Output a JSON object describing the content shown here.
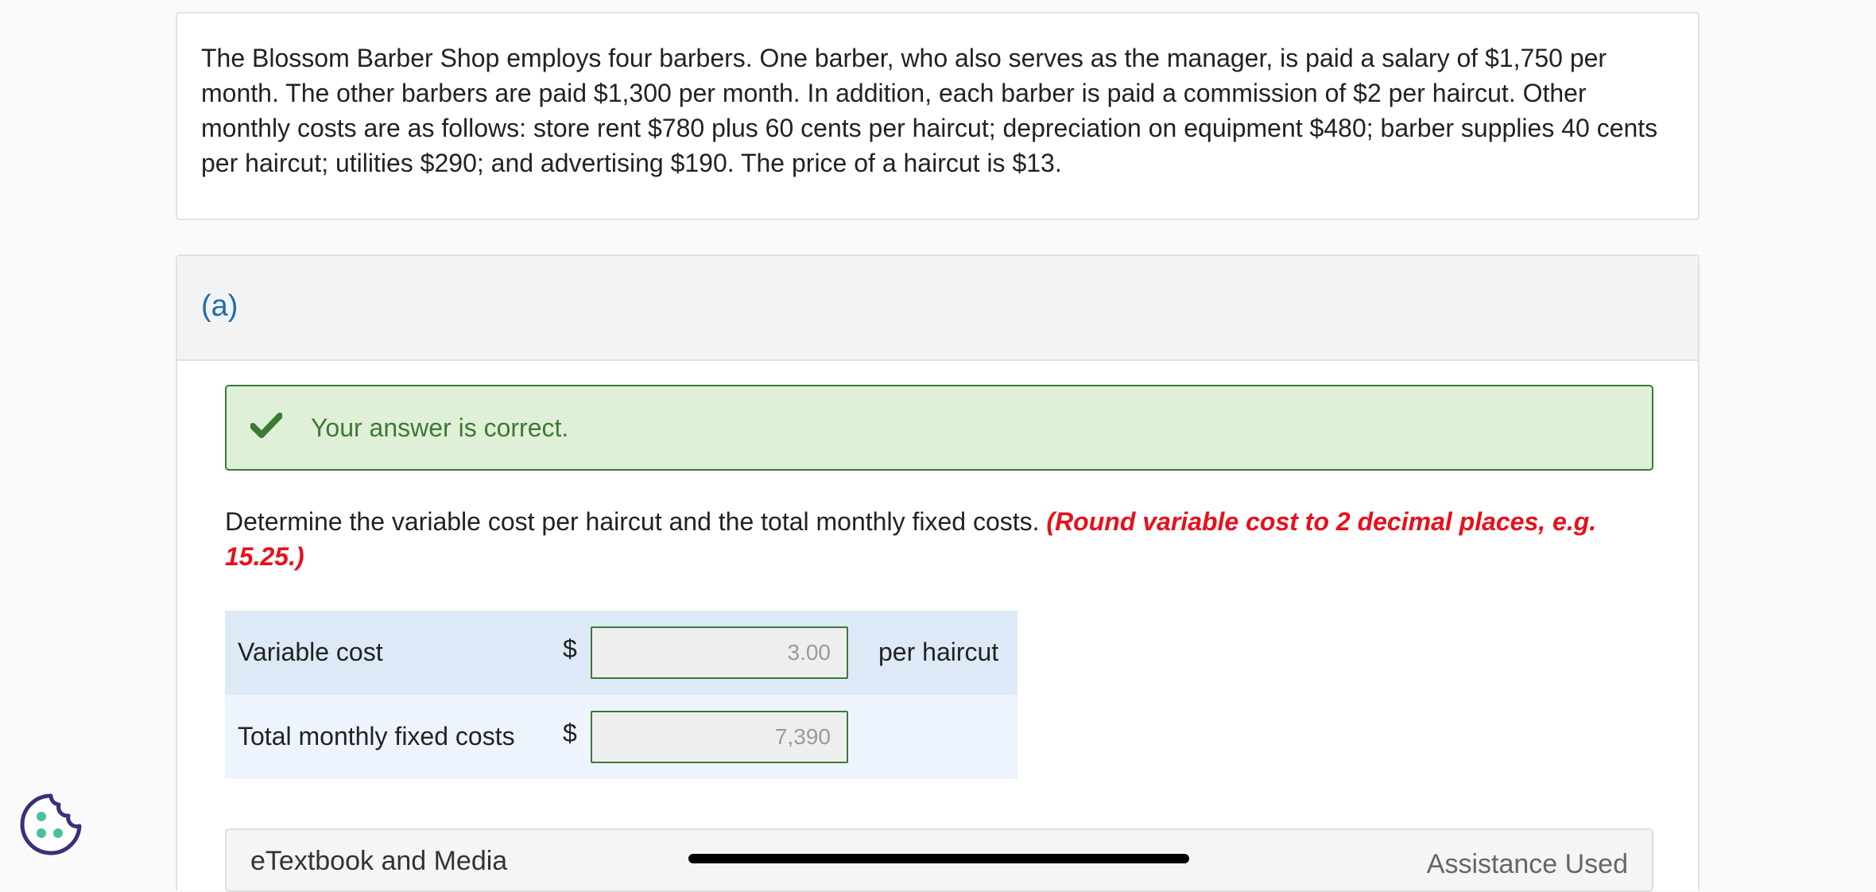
{
  "problem": {
    "text": "The Blossom Barber Shop employs four barbers. One barber, who also serves as the manager, is paid a salary of $1,750 per month. The other barbers are paid $1,300 per month. In addition, each barber is paid a commission of $2 per haircut. Other monthly costs are as follows: store rent $780 plus 60 cents per haircut; depreciation on equipment $480; barber supplies 40 cents per haircut; utilities $290; and advertising $190. The price of a haircut is $13."
  },
  "part": {
    "label": "(a)",
    "feedback": "Your answer is correct.",
    "question": "Determine the variable cost per haircut and the total monthly fixed costs.",
    "hint": "(Round variable cost to 2 decimal places, e.g. 15.25.)",
    "rows": [
      {
        "label": "Variable cost",
        "currency": "$",
        "value": "3.00",
        "unit": "per haircut"
      },
      {
        "label": "Total monthly fixed costs",
        "currency": "$",
        "value": "7,390",
        "unit": ""
      }
    ]
  },
  "footer": {
    "etextbook": "eTextbook and Media",
    "assistance": "Assistance Used"
  },
  "colors": {
    "correct_green": "#3b7a33",
    "hint_red": "#e8101a",
    "part_label_blue": "#1a6fb0"
  },
  "icons": [
    "check-icon",
    "cookie-icon"
  ]
}
